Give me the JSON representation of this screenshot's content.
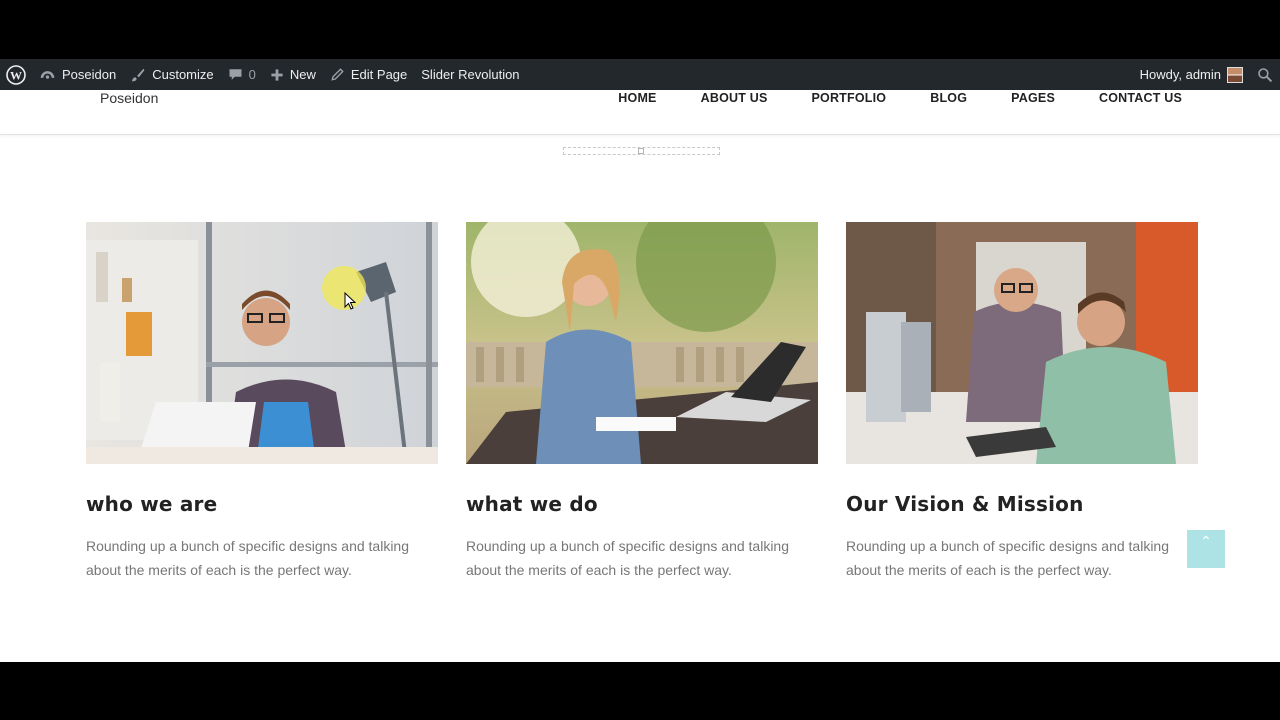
{
  "admin_bar": {
    "site_name": "Poseidon",
    "customize": "Customize",
    "comments_count": "0",
    "new": "New",
    "edit_page": "Edit Page",
    "slider_revolution": "Slider Revolution",
    "howdy": "Howdy, admin"
  },
  "site": {
    "title": "Poseidon",
    "nav": [
      "HOME",
      "ABOUT US",
      "PORTFOLIO",
      "BLOG",
      "PAGES",
      "CONTACT US"
    ]
  },
  "features": [
    {
      "heading": "who we are",
      "text": "Rounding up a bunch of specific designs and talking about the merits of each is the perfect way.",
      "image": "man-with-laptop-photo"
    },
    {
      "heading": "what we do",
      "text": "Rounding up a bunch of specific designs and talking about the merits of each is the perfect way.",
      "image": "woman-writing-photo"
    },
    {
      "heading": "Our Vision & Mission",
      "text": "Rounding up a bunch of specific designs and talking about the merits of each is the perfect way.",
      "image": "two-men-at-desk-photo"
    }
  ],
  "colors": {
    "admin_bar": "#23282d",
    "back_to_top": "#aee3e6"
  },
  "back_to_top_icon": "chevron-up-icon"
}
